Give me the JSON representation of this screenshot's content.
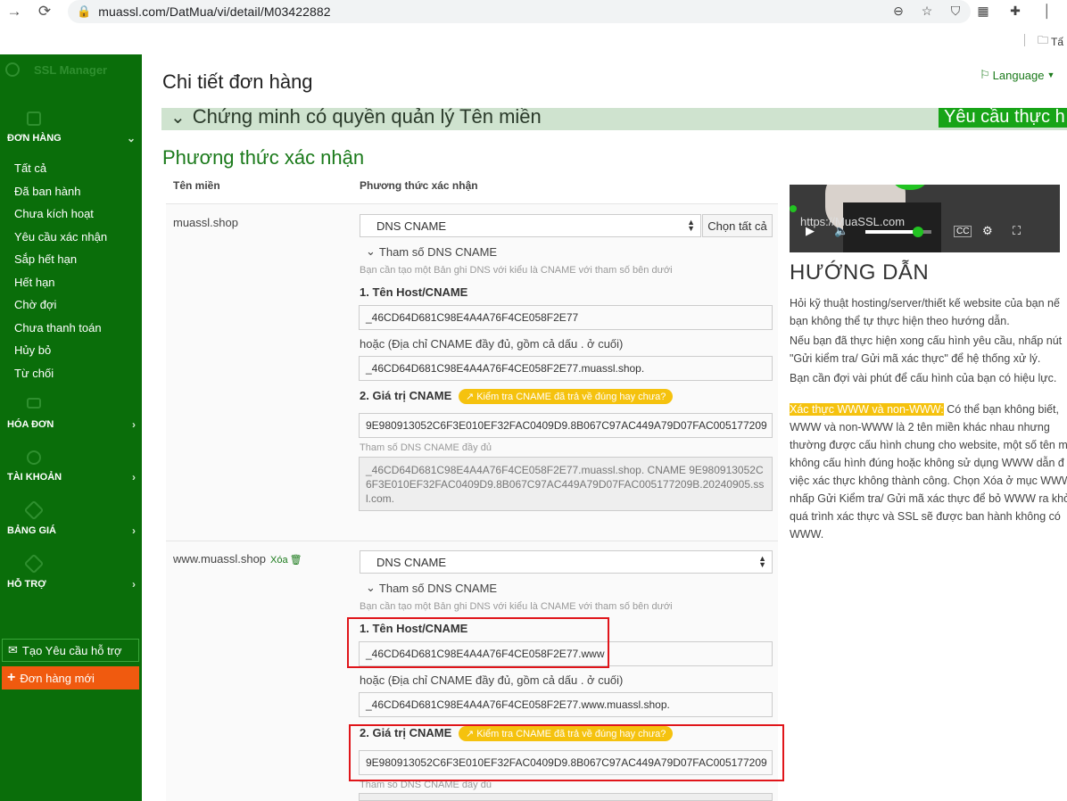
{
  "browser": {
    "url": "muassl.com/DatMua/vi/detail/M03422882",
    "bookmark": "Tấ"
  },
  "sidebar": {
    "brand": "SSL Manager",
    "orders_header": "ĐƠN HÀNG",
    "items": [
      "Tất cả",
      "Đã ban hành",
      "Chưa kích hoạt",
      "Yêu cầu xác nhận",
      "Sắp hết hạn",
      "Hết hạn",
      "Chờ đợi",
      "Chưa thanh toán",
      "Hủy bỏ",
      "Từ chối"
    ],
    "invoice_header": "HÓA ĐƠN",
    "account_header": "TÀI KHOẢN",
    "pricing_header": "BẢNG GIÁ",
    "support_header": "HỖ TRỢ",
    "support_button": "Tạo Yêu cầu hỗ trợ",
    "new_order_button": "Đơn hàng mới"
  },
  "header": {
    "title": "Chi tiết đơn hàng",
    "language": "Language"
  },
  "band": {
    "title": "Chứng minh có quyền quản lý Tên miền",
    "chip": "Yêu cầu thực h"
  },
  "section_title": "Phương thức xác nhận",
  "table": {
    "col_domain": "Tên miền",
    "col_method": "Phương thức xác nhận",
    "select_all": "Chọn tất cả",
    "delete_label": "Xóa",
    "rows": [
      {
        "domain": "muassl.shop",
        "method": "DNS CNAME",
        "params_toggle": "Tham số DNS CNAME",
        "hint": "Bạn cần tạo một Bản ghi DNS với kiểu là CNAME với tham số bên dưới",
        "host_label": "1. Tên Host/CNAME",
        "host_value": "_46CD64D681C98E4A4A76F4CE058F2E77",
        "or_label": "hoặc (Địa chỉ CNAME đầy đủ, gồm cả dấu . ở cuối)",
        "full_host": "_46CD64D681C98E4A4A76F4CE058F2E77.muassl.shop.",
        "value_label": "2. Giá trị CNAME",
        "check_badge": "Kiểm tra CNAME đã trả về đúng hay chưa?",
        "value": "9E980913052C6F3E010EF32FAC0409D9.8B067C97AC449A79D07FAC005177209",
        "full_label": "Tham số DNS CNAME đầy đủ",
        "full_value": "_46CD64D681C98E4A4A76F4CE058F2E77.muassl.shop. CNAME 9E980913052C6F3E010EF32FAC0409D9.8B067C97AC449A79D07FAC005177209B.20240905.ssl.com."
      },
      {
        "domain": "www.muassl.shop",
        "method": "DNS CNAME",
        "params_toggle": "Tham số DNS CNAME",
        "hint": "Bạn cần tạo một Bản ghi DNS với kiểu là CNAME với tham số bên dưới",
        "host_label": "1. Tên Host/CNAME",
        "host_value": "_46CD64D681C98E4A4A76F4CE058F2E77.www",
        "or_label": "hoặc (Địa chỉ CNAME đầy đủ, gồm cả dấu . ở cuối)",
        "full_host": "_46CD64D681C98E4A4A76F4CE058F2E77.www.muassl.shop.",
        "value_label": "2. Giá trị CNAME",
        "check_badge": "Kiểm tra CNAME đã trả về đúng hay chưa?",
        "value": "9E980913052C6F3E010EF32FAC0409D9.8B067C97AC449A79D07FAC005177209",
        "full_label": "Tham số DNS CNAME đầy đủ"
      }
    ]
  },
  "video": {
    "url_overlay": "https://MuaSSL.com",
    "progress": 0.8
  },
  "guide": {
    "title": "HƯỚNG DẪN",
    "p1": [
      "Hỏi kỹ thuật hosting/server/thiết kế website của bạn nế",
      "bạn không thể tự thực hiện theo hướng dẫn."
    ],
    "p2": [
      "Nếu bạn đã thực hiện xong cấu hình yêu cầu, nhấp nút",
      "\"Gửi kiểm tra/ Gửi mã xác thực\" để hệ thống xử lý."
    ],
    "p3": "Bạn cần đợi vài phút để cấu hình của bạn có hiệu lực.",
    "p4_highlight": "Xác thực WWW và non-WWW:",
    "p4_first": " Có thể bạn không biết,",
    "p4_lines": [
      "WWW và non-WWW là 2 tên miền khác nhau nhưng",
      "thường được cấu hình chung cho website, một số tên m",
      "không cấu hình đúng hoặc không sử dụng WWW dẫn đ",
      "việc xác thực không thành công. Chọn Xóa ở mục WWW",
      "nhấp Gửi Kiểm tra/ Gửi mã xác thực để bỏ WWW ra khỏ",
      "quá trình xác thực và SSL sẽ được ban hành không có",
      "WWW."
    ]
  }
}
